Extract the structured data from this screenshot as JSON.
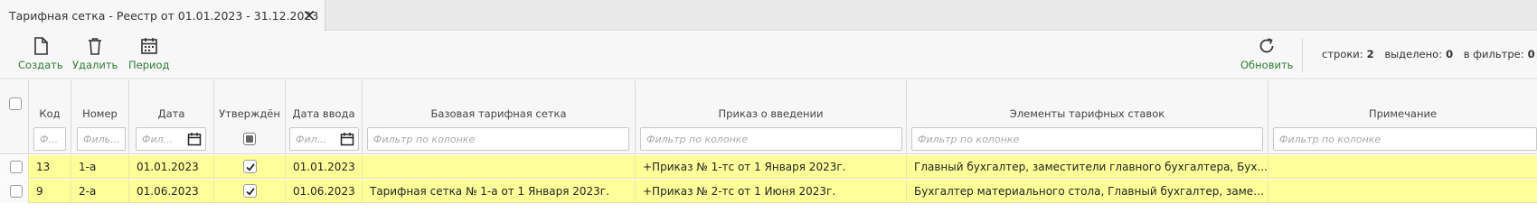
{
  "tab": {
    "title": "Тарифная сетка - Реестр от 01.01.2023 - 31.12.2023",
    "close_icon": "close-icon"
  },
  "toolbar": {
    "create_label": "Создать",
    "delete_label": "Удалить",
    "period_label": "Период",
    "refresh_label": "Обновить",
    "label_color": "#2e7d32"
  },
  "counters": {
    "rows_label": "строки:",
    "rows_value": "2",
    "selected_label": "выделено:",
    "selected_value": "0",
    "filtered_label": "в фильтре:",
    "filtered_value": "0",
    "more": "⋮"
  },
  "columns": {
    "code": {
      "title": "Код",
      "placeholder": "Ф..."
    },
    "number": {
      "title": "Номер",
      "placeholder": "Филь..."
    },
    "date": {
      "title": "Дата",
      "placeholder": "Фил..."
    },
    "approved": {
      "title": "Утверждён"
    },
    "entry_date": {
      "title": "Дата ввода",
      "placeholder": "Фил..."
    },
    "base_grid": {
      "title": "Базовая тарифная сетка",
      "placeholder": "Фильтр по колонке"
    },
    "order": {
      "title": "Приказ о введении",
      "placeholder": "Фильтр по колонке"
    },
    "elements": {
      "title": "Элементы тарифных ставок",
      "placeholder": "Фильтр по колонке"
    },
    "note": {
      "title": "Примечание",
      "placeholder": "Фильтр по колонке"
    }
  },
  "rows": [
    {
      "code": "13",
      "number": "1-а",
      "date": "01.01.2023",
      "approved": true,
      "entry_date": "01.01.2023",
      "base_grid": "",
      "order": "+Приказ № 1-тс от 1 Января 2023г.",
      "elements": "Главный бухгалтер, заместители главного бухгалтера, Бух...",
      "note": ""
    },
    {
      "code": "9",
      "number": "2-а",
      "date": "01.06.2023",
      "approved": true,
      "entry_date": "01.06.2023",
      "base_grid": "Тарифная сетка № 1-а от 1 Января 2023г.",
      "order": "+Приказ № 2-тс от 1 Июня 2023г.",
      "elements": "Бухгалтер материального стола, Главный бухгалтер, замес...",
      "note": ""
    }
  ],
  "colors": {
    "row_highlight": "#ffff99",
    "toolbar_bg": "#f7f7f7"
  }
}
